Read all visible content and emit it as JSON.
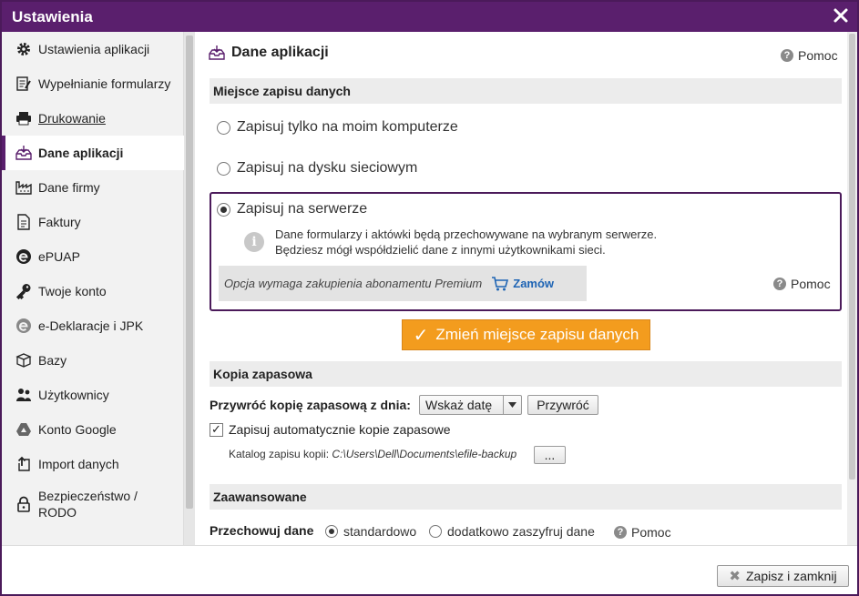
{
  "window": {
    "title": "Ustawienia"
  },
  "sidebar": {
    "items": [
      {
        "label": "Ustawienia aplikacji",
        "icon": "gear-icon"
      },
      {
        "label": "Wypełnianie formularzy",
        "icon": "form-edit-icon"
      },
      {
        "label": "Drukowanie",
        "icon": "printer-icon"
      },
      {
        "label": "Dane aplikacji",
        "icon": "inbox-download-icon"
      },
      {
        "label": "Dane firmy",
        "icon": "factory-icon"
      },
      {
        "label": "Faktury",
        "icon": "document-icon"
      },
      {
        "label": "ePUAP",
        "icon": "epuap-icon"
      },
      {
        "label": "Twoje konto",
        "icon": "key-icon"
      },
      {
        "label": "e-Deklaracje i JPK",
        "icon": "e-declaration-icon"
      },
      {
        "label": "Bazy",
        "icon": "box-icon"
      },
      {
        "label": "Użytkownicy",
        "icon": "users-icon"
      },
      {
        "label": "Konto Google",
        "icon": "google-drive-icon"
      },
      {
        "label": "Import danych",
        "icon": "import-icon"
      },
      {
        "label": "Bezpieczeństwo / RODO",
        "icon": "lock-icon"
      }
    ],
    "active_index": 3
  },
  "main": {
    "title": "Dane aplikacji",
    "help_label": "Pomoc",
    "storage": {
      "section_title": "Miejsce zapisu danych",
      "options": [
        {
          "label": "Zapisuj tylko na moim komputerze",
          "checked": false
        },
        {
          "label": "Zapisuj na dysku sieciowym",
          "checked": false
        },
        {
          "label": "Zapisuj na serwerze",
          "checked": true
        }
      ],
      "server_desc_line1": "Dane formularzy i aktówki będą przechowywane na wybranym serwerze.",
      "server_desc_line2": "Będziesz mógł współdzielić dane z innymi użytkownikami sieci.",
      "premium_note": "Opcja wymaga zakupienia abonamentu Premium",
      "order_label": "Zamów",
      "box_help_label": "Pomoc",
      "change_button": "Zmień miejsce zapisu danych"
    },
    "backup": {
      "section_title": "Kopia zapasowa",
      "restore_label": "Przywróć kopię zapasową z dnia:",
      "date_select_value": "Wskaż datę",
      "restore_button": "Przywróć",
      "auto_backup_label": "Zapisuj automatycznie kopie zapasowe",
      "auto_backup_checked": true,
      "catalog_label": "Katalog zapisu kopii:",
      "catalog_path": "C:\\Users\\Dell\\Documents\\efile-backup",
      "browse_button": "..."
    },
    "advanced": {
      "section_title": "Zaawansowane",
      "store_label": "Przechowuj dane",
      "options": [
        {
          "label": "standardowo",
          "checked": true
        },
        {
          "label": "dodatkowo zaszyfruj dane",
          "checked": false
        }
      ],
      "help_label": "Pomoc"
    }
  },
  "footer": {
    "save_close_button": "Zapisz i zamknij"
  },
  "colors": {
    "accent": "#5a1f6d",
    "orange": "#f39c1e",
    "link": "#1e64b4"
  }
}
